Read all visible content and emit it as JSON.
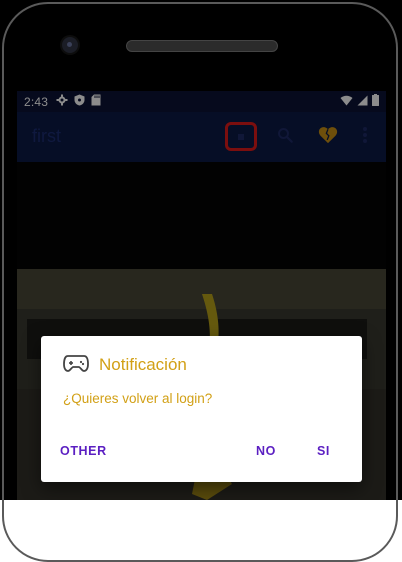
{
  "status_bar": {
    "time": "2:43",
    "left_icons": [
      "gear-icon",
      "shield-icon",
      "sd-card-icon"
    ],
    "right_icons": [
      "wifi-icon",
      "signal-icon",
      "battery-icon"
    ]
  },
  "app_bar": {
    "title": "first",
    "actions": [
      {
        "name": "highlighted-action",
        "icon": "dot-icon"
      },
      {
        "name": "search",
        "icon": "search-icon"
      },
      {
        "name": "favorite",
        "icon": "broken-heart-icon"
      },
      {
        "name": "overflow-menu",
        "icon": "more-vert-icon"
      }
    ]
  },
  "dialog": {
    "icon": "gamepad-icon",
    "title": "Notificación",
    "message": "¿Quieres volver al login?",
    "buttons": {
      "other": "OTHER",
      "no": "NO",
      "yes": "SI"
    }
  },
  "colors": {
    "status_bar": "#0c1336",
    "app_bar": "#0c1a45",
    "title": "#1d2e74",
    "dialog_text": "#d2a016",
    "button_text": "#5b1fc2",
    "highlight": "#e01b1b"
  }
}
